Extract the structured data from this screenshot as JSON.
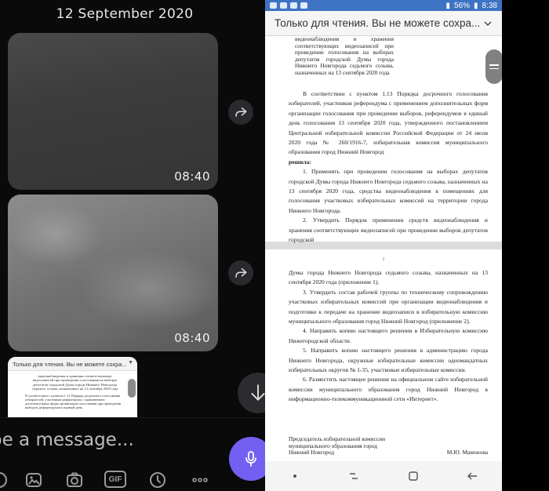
{
  "chat": {
    "date_header": "12 September 2020",
    "messages": [
      {
        "time": "08:40"
      },
      {
        "time": "08:40"
      }
    ],
    "thumbnail": {
      "title": "Только для чтения. Вы не можете сохра...",
      "head_text": "видеонаблюдения и хранения соответствующих видеозаписей при проведении голосования на выборах депутатов городской Думы города Нижнего Новгорода седьмого созыва, назначенных на 13 сентября 2020 года",
      "body_text": "В соответствии с пунктом 1.13 Порядка досрочного голосования избирателей, участников референдума с применением дополнительных форм организации голосования при проведении выборов, референдумов в единый день"
    },
    "composer": {
      "placeholder": "pe a message..."
    },
    "toolbar_icons": [
      "sticker-icon",
      "image-icon",
      "camera-icon",
      "gif-icon",
      "clock-icon",
      "more-icon",
      "mic-icon"
    ],
    "gif_label": "GIF"
  },
  "viewer": {
    "status_bar": {
      "battery": "56%",
      "time": "8:38"
    },
    "title": "Только для чтения. Вы не можете сохра...",
    "page1": {
      "head": "видеонаблюдения и хранения соответствующих видеозаписей при проведении голосования на выборах депутатов городской Думы города Нижнего Новгорода седьмого созыва, назначенных на 13 сентября 2020 года",
      "p1": "В соответствии с пунктом 1.13 Порядка досрочного голосования избирателей, участников референдума с применением дополнительных форм организации голосования при проведении выборов, референдумов в единый день голосования 13 сентября 2020 года, утвержденного постановлением Центральной избирательной комиссии Российской Федерации от 24 июля 2020 года № 260/1916-7, избирательная комиссия муниципального образования город Нижний Новгород",
      "resolved": "решила:",
      "p2": "1. Применять при проведении голосования на выборах депутатов городской Думы города Нижнего Новгорода седьмого созыва, назначенных на 13 сентября 2020 года, средства видеонаблюдения в помещениях для голосования участковых избирательных комиссий на территории города Нижнего Новгорода.",
      "p3": "2. Утвердить Порядок применения средств видеонаблюдения и хранения соответствующих видеозаписей при проведении выборов депутатов городской"
    },
    "page2": {
      "page_number": "2",
      "p1": "Думы города Нижнего Новгорода седьмого созыва, назначенных на 13 сентября 2020 года (приложение 1).",
      "p2": "3. Утвердить состав рабочей группы по техническому сопровождению участковых избирательных комиссий при организации видеонаблюдения и подготовке к передаче на хранение видеозаписи в избирательную комиссию муниципального образования город Нижний Новгород (приложение 2).",
      "p3": "4. Направить копию настоящего решения в Избирательную комиссию Нижегородской области.",
      "p4": "5. Направить копию настоящего решения в администрацию города Нижнего Новгорода, окружные избирательные комиссии одномандатных избирательных округов № 1-35, участковые избирательные комиссии.",
      "p5": "6. Разместить настоящее решение на официальном сайте избирательной комиссии муниципального образования город Нижний Новгород в информационно-телекоммуникационной сети «Интернет».",
      "signature_left": "Председатель избирательной комиссии муниципального образования город Нижний Новгород",
      "signature_right": "М.Ю. Мамонова"
    }
  }
}
